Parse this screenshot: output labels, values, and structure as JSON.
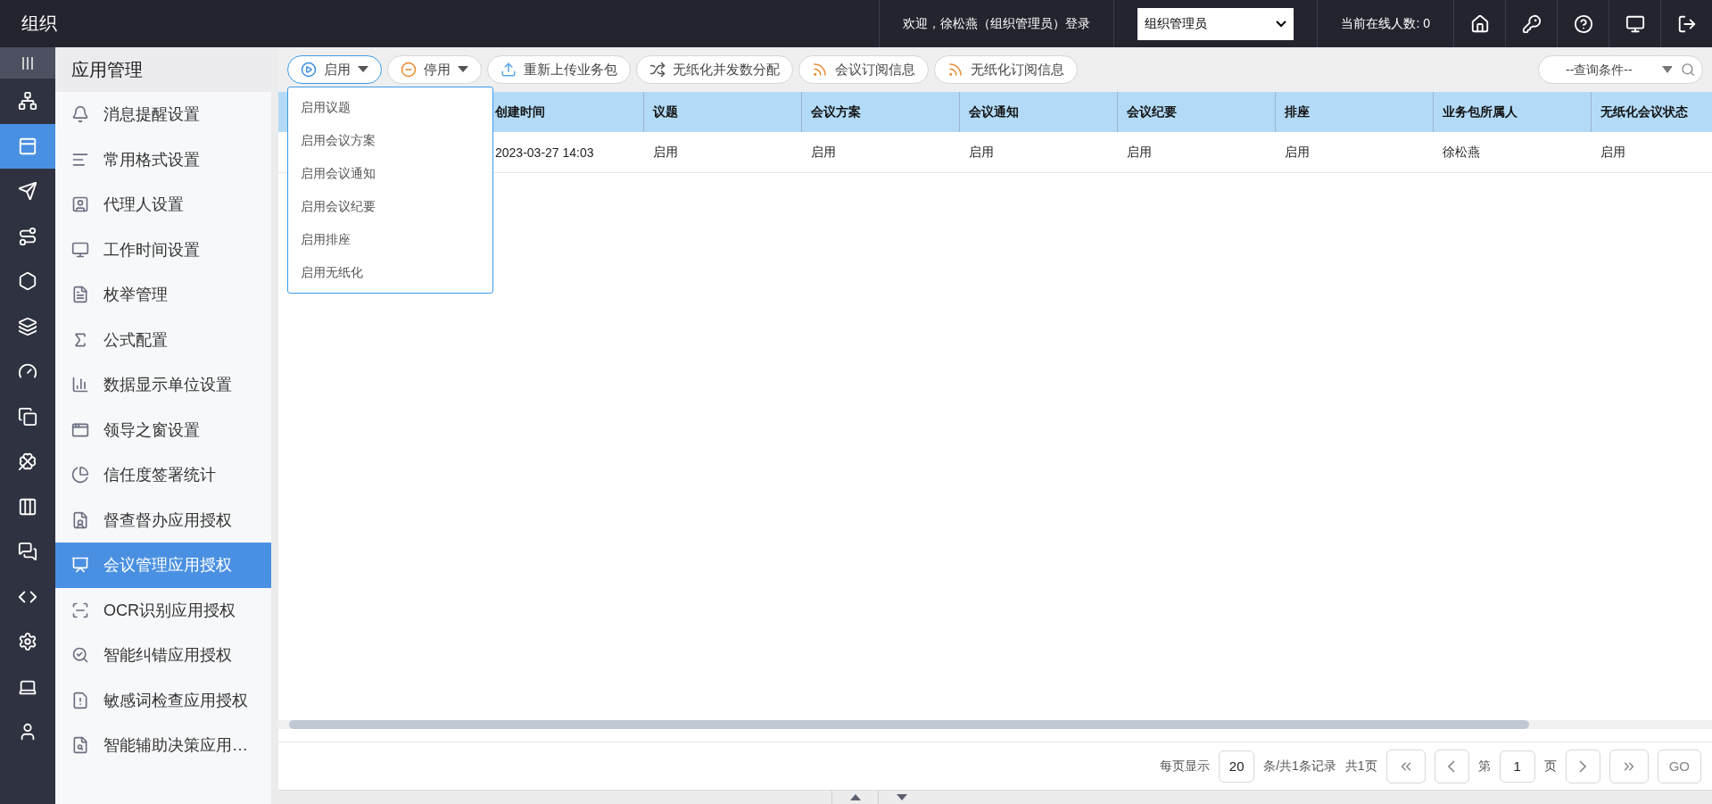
{
  "topbar": {
    "title": "组织",
    "welcome": "欢迎，徐松燕（组织管理员）登录",
    "role_select": {
      "value": "组织管理员"
    },
    "online_count": "当前在线人数: 0"
  },
  "rail": {
    "expanded": true,
    "items": [
      {
        "selected": false
      },
      {
        "selected": true
      },
      {
        "selected": false
      },
      {
        "selected": false
      },
      {
        "selected": false
      },
      {
        "selected": false
      },
      {
        "selected": false
      },
      {
        "selected": false
      },
      {
        "selected": false
      },
      {
        "selected": false
      },
      {
        "selected": false
      },
      {
        "selected": false
      },
      {
        "selected": false
      },
      {
        "selected": false
      },
      {
        "selected": false
      }
    ]
  },
  "subnav": {
    "title": "应用管理",
    "items": [
      {
        "label": "消息提醒设置",
        "selected": false
      },
      {
        "label": "常用格式设置",
        "selected": false
      },
      {
        "label": "代理人设置",
        "selected": false
      },
      {
        "label": "工作时间设置",
        "selected": false
      },
      {
        "label": "枚举管理",
        "selected": false
      },
      {
        "label": "公式配置",
        "selected": false
      },
      {
        "label": "数据显示单位设置",
        "selected": false
      },
      {
        "label": "领导之窗设置",
        "selected": false
      },
      {
        "label": "信任度签署统计",
        "selected": false
      },
      {
        "label": "督查督办应用授权",
        "selected": false
      },
      {
        "label": "会议管理应用授权",
        "selected": true
      },
      {
        "label": "OCR识别应用授权",
        "selected": false
      },
      {
        "label": "智能纠错应用授权",
        "selected": false
      },
      {
        "label": "敏感词检查应用授权",
        "selected": false
      },
      {
        "label": "智能辅助决策应用…",
        "selected": false
      }
    ]
  },
  "toolbar": {
    "buttons": [
      {
        "label": "启用",
        "kind": "dropdown",
        "expanded": true
      },
      {
        "label": "停用",
        "kind": "dropdown",
        "expanded": false
      },
      {
        "label": "重新上传业务包",
        "kind": "plain"
      },
      {
        "label": "无纸化并发数分配",
        "kind": "plain"
      },
      {
        "label": "会议订阅信息",
        "kind": "plain"
      },
      {
        "label": "无纸化订阅信息",
        "kind": "plain"
      }
    ],
    "search": {
      "placeholder": "--查询条件--"
    }
  },
  "dropdown_menu": {
    "items": [
      "启用议题",
      "启用会议方案",
      "启用会议通知",
      "启用会议纪要",
      "启用排座",
      "启用无纸化"
    ]
  },
  "table": {
    "columns": [
      "创建时间",
      "议题",
      "会议方案",
      "会议通知",
      "会议纪要",
      "排座",
      "业务包所属人",
      "无纸化会议状态"
    ],
    "rows": [
      [
        "2023-03-27 14:03",
        "启用",
        "启用",
        "启用",
        "启用",
        "启用",
        "徐松燕",
        "启用"
      ]
    ]
  },
  "pagination": {
    "per_page_label": "每页显示",
    "per_page": "20",
    "records": "条/共1条记录",
    "pages": "共1页",
    "page_prefix": "第",
    "page": "1",
    "page_suffix": "页",
    "go": "GO"
  }
}
